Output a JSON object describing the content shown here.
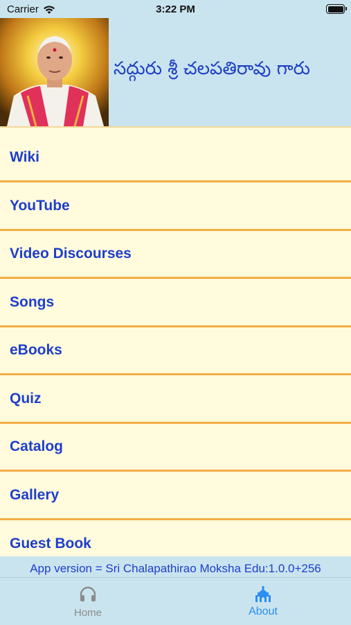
{
  "status_bar": {
    "carrier": "Carrier",
    "time": "3:22 PM"
  },
  "header": {
    "title": "సద్గురు శ్రీ చలపతిరావు గారు"
  },
  "menu": {
    "items": [
      {
        "label": "Wiki"
      },
      {
        "label": "YouTube"
      },
      {
        "label": "Video Discourses"
      },
      {
        "label": "Songs"
      },
      {
        "label": "eBooks"
      },
      {
        "label": "Quiz"
      },
      {
        "label": "Catalog"
      },
      {
        "label": "Gallery"
      },
      {
        "label": "Guest Book"
      }
    ]
  },
  "footer": {
    "version_text": "App version = Sri Chalapathirao Moksha Edu:1.0.0+256"
  },
  "tabbar": {
    "tabs": [
      {
        "label": "Home",
        "icon": "headphones-icon",
        "active": false
      },
      {
        "label": "About",
        "icon": "temple-icon",
        "active": true
      }
    ]
  },
  "colors": {
    "header_bg": "#c9e4ef",
    "menu_bg": "#fffbdc",
    "menu_divider": "#f2ad45",
    "link_text": "#1e3ecb",
    "tab_active": "#2c8ef2",
    "tab_inactive": "#8a8a8a"
  }
}
